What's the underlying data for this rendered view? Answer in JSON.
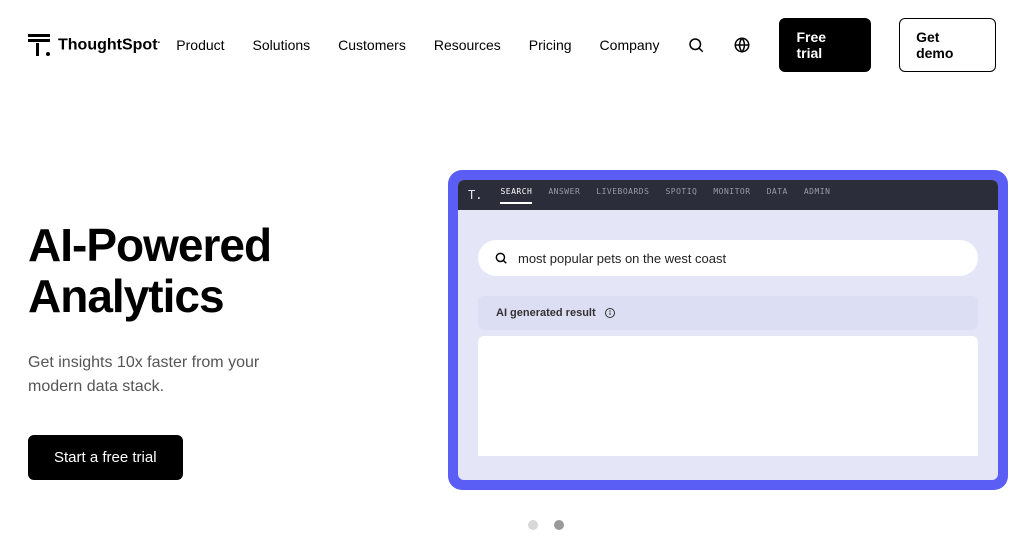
{
  "brand": "ThoughtSpot",
  "nav": {
    "product": "Product",
    "solutions": "Solutions",
    "customers": "Customers",
    "resources": "Resources",
    "pricing": "Pricing",
    "company": "Company"
  },
  "header_cta": {
    "free_trial": "Free trial",
    "get_demo": "Get demo"
  },
  "hero": {
    "title_line1": "AI-Powered",
    "title_line2": "Analytics",
    "subtitle": "Get insights 10x faster from your modern data stack.",
    "cta": "Start a free trial"
  },
  "embedded_app": {
    "tabs": {
      "search": "SEARCH",
      "answer": "ANSWER",
      "liveboards": "LIVEBOARDS",
      "spotiq": "SPOTIQ",
      "monitor": "MONITOR",
      "data": "DATA",
      "admin": "ADMIN"
    },
    "search_query": "most popular pets on the west coast",
    "result_label": "AI generated result"
  }
}
